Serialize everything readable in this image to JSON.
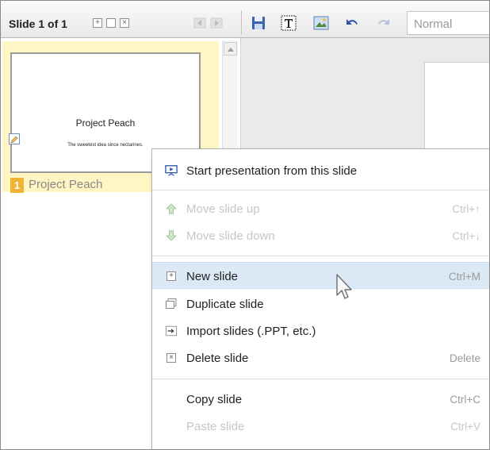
{
  "toolbar": {
    "slide_counter": "Slide 1 of 1",
    "style_select_value": "Normal",
    "mini_add": "+",
    "mini_delete": "×"
  },
  "slide_panel": {
    "slides": [
      {
        "number": "1",
        "name": "Project Peach",
        "title": "Project Peach",
        "subtitle": "The sweetest idea since nectarines."
      }
    ]
  },
  "context_menu": {
    "items": [
      {
        "label": "Start presentation from this slide",
        "shortcut": "",
        "icon": "presentation-icon",
        "disabled": false
      },
      {
        "label": "Move slide up",
        "shortcut": "Ctrl+↑",
        "icon": "arrow-up-icon",
        "disabled": true
      },
      {
        "label": "Move slide down",
        "shortcut": "Ctrl+↓",
        "icon": "arrow-down-icon",
        "disabled": true
      },
      {
        "label": "New slide",
        "shortcut": "Ctrl+M",
        "icon": "new-slide-icon",
        "disabled": false
      },
      {
        "label": "Duplicate slide",
        "shortcut": "",
        "icon": "duplicate-icon",
        "disabled": false
      },
      {
        "label": "Import slides (.PPT, etc.)",
        "shortcut": "",
        "icon": "import-icon",
        "disabled": false
      },
      {
        "label": "Delete slide",
        "shortcut": "Delete",
        "icon": "delete-icon",
        "disabled": false
      },
      {
        "label": "Copy slide",
        "shortcut": "Ctrl+C",
        "icon": "",
        "disabled": false
      },
      {
        "label": "Paste slide",
        "shortcut": "Ctrl+V",
        "icon": "",
        "disabled": true
      }
    ]
  },
  "colors": {
    "highlight": "#dbe9f7",
    "slide_selected_bg": "#fff6c4",
    "slide_number_badge": "#f2b234",
    "disabled_text": "#c6c6c6"
  }
}
